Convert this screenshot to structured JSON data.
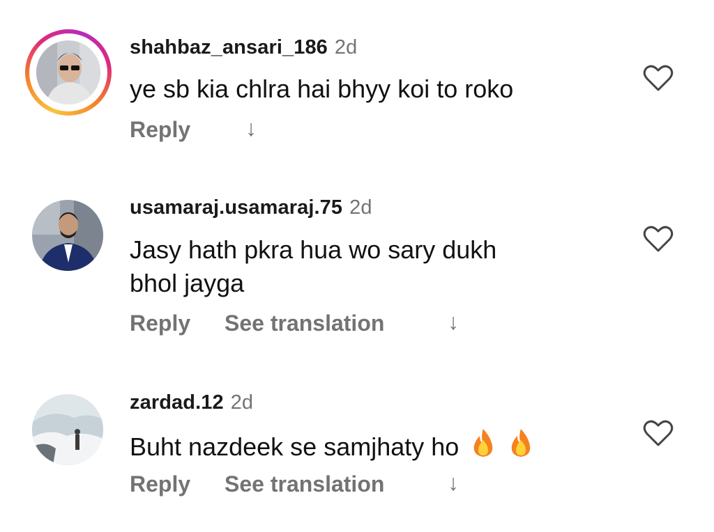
{
  "comments": [
    {
      "username": "shahbaz_ansari_186",
      "time": "2d",
      "text": "ye sb kia chlra hai bhyy koi to roko",
      "reply": "Reply",
      "see_translation": ""
    },
    {
      "username": "usamaraj.usamaraj.75",
      "time": "2d",
      "text_line1": "Jasy hath pkra hua wo sary dukh",
      "text_line2": "bhol jayga",
      "reply": "Reply",
      "see_translation": "See translation"
    },
    {
      "username": "zardad.12",
      "time": "2d",
      "text": "Buht nazdeek se samjhaty ho",
      "reply": "Reply",
      "see_translation": "See translation"
    }
  ],
  "icons": {
    "like": "heart-outline-icon",
    "expand": "arrow-down-icon",
    "emoji": "fire-emoji"
  },
  "colors": {
    "secondary_text": "#737373",
    "story_ring": "#dd2a7b"
  }
}
